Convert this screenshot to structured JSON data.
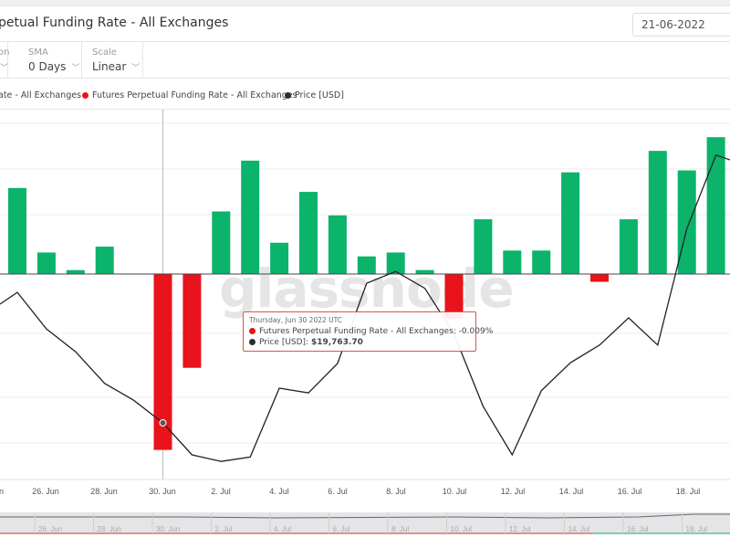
{
  "header": {
    "title": "petual Funding Rate - All Exchanges",
    "date": "21-06-2022"
  },
  "controls": [
    {
      "label": "on",
      "value": ""
    },
    {
      "label": "SMA",
      "value": "0 Days"
    },
    {
      "label": "Scale",
      "value": "Linear"
    }
  ],
  "legend": [
    {
      "label": "ate - All Exchanges",
      "color": "#0bb36b"
    },
    {
      "label": "Futures Perpetual Funding Rate - All Exchanges",
      "color": "#e8131b"
    },
    {
      "label": "Price [USD]",
      "color": "#2a2e33"
    }
  ],
  "watermark": "glassnode",
  "tooltip": {
    "date": "Thursday, Jun 30 2022 UTC",
    "line1": "Futures Perpetual Funding Rate - All Exchanges: -0.009%",
    "line2_label": "Price [USD]: ",
    "line2_value": "$19,763.70"
  },
  "chart_data": {
    "type": "bar",
    "positive_color": "#0bb36b",
    "negative_color": "#e8131b",
    "price_color": "#222222",
    "x": [
      "25 Jun",
      "26 Jun",
      "27 Jun",
      "28 Jun",
      "29 Jun",
      "30 Jun",
      "1 Jul",
      "2 Jul",
      "3 Jul",
      "4 Jul",
      "5 Jul",
      "6 Jul",
      "7 Jul",
      "8 Jul",
      "9 Jul",
      "10 Jul",
      "11 Jul",
      "12 Jul",
      "13 Jul",
      "14 Jul",
      "15 Jul",
      "16 Jul",
      "17 Jul",
      "18 Jul",
      "19 Jul"
    ],
    "series": [
      {
        "name": "Futures Perpetual Funding Rate - All Exchanges",
        "unit": "%",
        "type": "bar",
        "values": [
          0.0044,
          0.0011,
          0.0002,
          0.0014,
          0.0,
          -0.009,
          -0.0048,
          0.0032,
          0.0058,
          0.0016,
          0.0042,
          0.003,
          0.0009,
          0.0011,
          0.0002,
          -0.0023,
          0.0028,
          0.0012,
          0.0012,
          0.0052,
          -0.0004,
          0.0028,
          0.0063,
          0.0053,
          0.007
        ]
      },
      {
        "name": "Price [USD]",
        "type": "line",
        "values": [
          21536,
          21040,
          20730,
          20300,
          20070,
          19763.7,
          19330,
          19240,
          19300,
          20235,
          20170,
          20570,
          21660,
          21820,
          21590,
          20970,
          19990,
          19330,
          20200,
          20580,
          20820,
          21190,
          20820,
          22400,
          23400
        ]
      }
    ],
    "xtick_labels": [
      "n",
      "26. Jun",
      "28. Jun",
      "30. Jun",
      "2. Jul",
      "4. Jul",
      "6. Jul",
      "8. Jul",
      "10. Jul",
      "12. Jul",
      "14. Jul",
      "16. Jul",
      "18. Jul"
    ],
    "navigator_labels": [
      "n",
      "26. Jun",
      "28. Jun",
      "30. Jun",
      "2. Jul",
      "4. Jul",
      "6. Jul",
      "8. Jul",
      "10. Jul",
      "12. Jul",
      "14. Jul",
      "16. Jul",
      "18. Jul"
    ],
    "crosshair_date": "30 Jun",
    "grid": true
  }
}
